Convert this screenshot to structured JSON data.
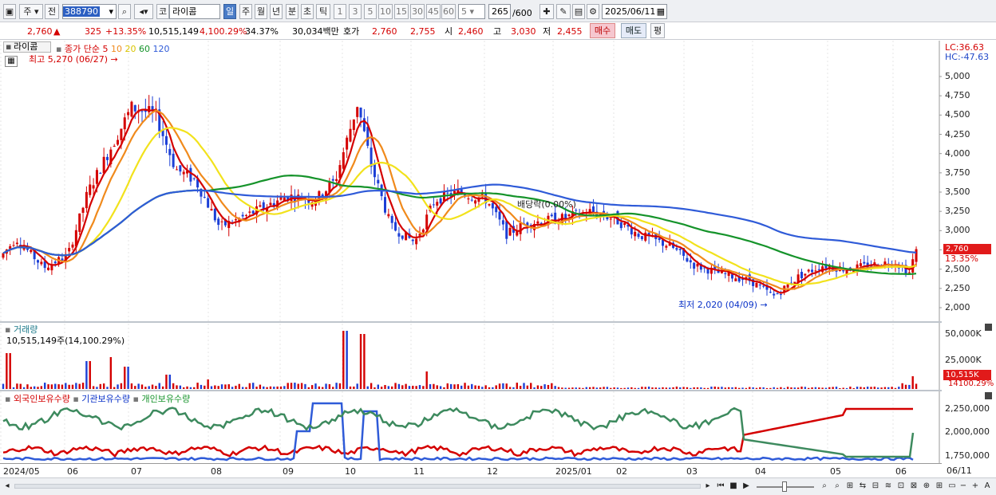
{
  "toolbar": {
    "mode": "주",
    "prev": "전",
    "code": "388790",
    "market": "코",
    "name": "라이콤",
    "periods": [
      "일",
      "주",
      "월",
      "년",
      "분",
      "초",
      "틱"
    ],
    "mins": [
      "1",
      "3",
      "5",
      "10",
      "15",
      "30",
      "45",
      "60"
    ],
    "custom": "5",
    "count": "265",
    "total": "/600",
    "date": "2025/06/11"
  },
  "info": {
    "price": "2,760",
    "arrow": "▲",
    "change": "325",
    "rate": "+13.35%",
    "volume": "10,515,149",
    "vol_rate": "4,100.29%",
    "turnover": "34.37%",
    "amount": "30,034백만",
    "hoga_label": "호가",
    "ask": "2,760",
    "bid": "2,755",
    "open_label": "시",
    "open": "2,460",
    "high_label": "고",
    "high": "3,030",
    "low_label": "저",
    "low": "2,455",
    "buy": "매수",
    "sell": "매도",
    "eval": "평"
  },
  "price_panel": {
    "name": "라이콤",
    "legend_prefix": "종가 단순",
    "ma": [
      "5",
      "10",
      "20",
      "60",
      "120"
    ],
    "high_note": "최고 5,270 (06/27)",
    "low_note": "최저 2,020 (04/09)",
    "dividend": "배당락(0.00%)",
    "lc": "LC:36.63",
    "hc": "HC:-47.63",
    "yticks": [
      "5,000",
      "4,750",
      "4,500",
      "4,250",
      "4,000",
      "3,750",
      "3,500",
      "3,250",
      "3,000",
      "2,750",
      "2,500",
      "2,250",
      "2,000"
    ],
    "cur_tag": "2,760",
    "rate_tag": "13.35%"
  },
  "volume_panel": {
    "title": "거래량",
    "value": "10,515,149주(14,100.29%)",
    "yticks": [
      "50,000K",
      "25,000K"
    ],
    "tag": "10,515K",
    "tag2": "14100.29%"
  },
  "holding_panel": {
    "legend": [
      "외국인보유수량",
      "기관보유수량",
      "개인보유수량"
    ],
    "yticks": [
      "2,250,000",
      "2,000,000",
      "1,750,000"
    ]
  },
  "xaxis": [
    "2024/05",
    "06",
    "07",
    "08",
    "09",
    "10",
    "11",
    "12",
    "2025/01",
    "02",
    "03",
    "04",
    "05",
    "06",
    "06/11"
  ],
  "colors": {
    "up": "#d40000",
    "down": "#1c3fd6",
    "ma5": "#d40000",
    "ma10": "#f08a1c",
    "ma20": "#f2e21c",
    "ma60": "#15932a",
    "ma120": "#2f5bd8"
  },
  "chart_data": {
    "type": "candlestick",
    "x_start": "2024/05",
    "x_end": "2025/06/11",
    "ylim": [
      2000,
      5300
    ],
    "high": 5270,
    "high_date": "06/27",
    "low": 2020,
    "low_date": "04/09",
    "close": 2760,
    "series": [
      {
        "name": "5"
      },
      {
        "name": "10"
      },
      {
        "name": "20"
      },
      {
        "name": "60"
      },
      {
        "name": "120"
      }
    ]
  }
}
